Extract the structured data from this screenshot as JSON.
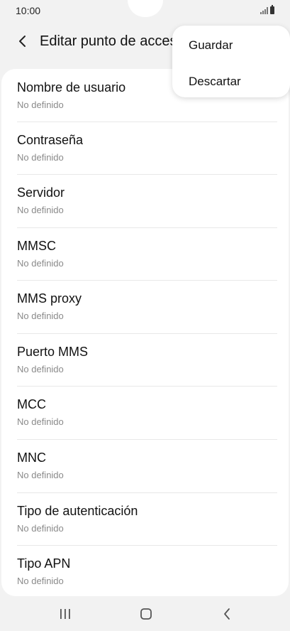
{
  "status_bar": {
    "time": "10:00"
  },
  "header": {
    "title": "Editar punto de acceso",
    "back_icon": "chevron-left-icon"
  },
  "menu": {
    "items": [
      {
        "label": "Guardar"
      },
      {
        "label": "Descartar"
      }
    ]
  },
  "list": {
    "items": [
      {
        "title": "Nombre de usuario",
        "value": "No definido"
      },
      {
        "title": "Contraseña",
        "value": "No definido"
      },
      {
        "title": "Servidor",
        "value": "No definido"
      },
      {
        "title": "MMSC",
        "value": "No definido"
      },
      {
        "title": "MMS proxy",
        "value": "No definido"
      },
      {
        "title": "Puerto MMS",
        "value": "No definido"
      },
      {
        "title": "MCC",
        "value": "No definido"
      },
      {
        "title": "MNC",
        "value": "No definido"
      },
      {
        "title": "Tipo de autenticación",
        "value": "No definido"
      },
      {
        "title": "Tipo APN",
        "value": "No definido"
      }
    ]
  },
  "nav_bar": {
    "icons": [
      "recent-apps-icon",
      "home-icon",
      "back-icon"
    ]
  }
}
